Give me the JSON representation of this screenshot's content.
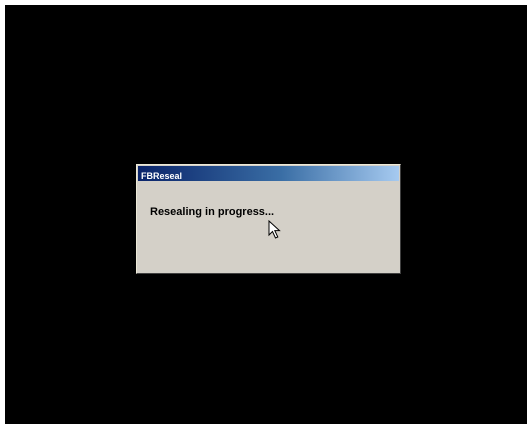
{
  "dialog": {
    "title": "FBReseal",
    "message": "Resealing in progress..."
  },
  "icons": {
    "cursor": "mouse-pointer-icon"
  },
  "colors": {
    "desktop": "#000000",
    "dialog_face": "#d4d0c8",
    "titlebar_start": "#0a246a",
    "titlebar_end": "#a6caf0",
    "title_text": "#ffffff"
  }
}
